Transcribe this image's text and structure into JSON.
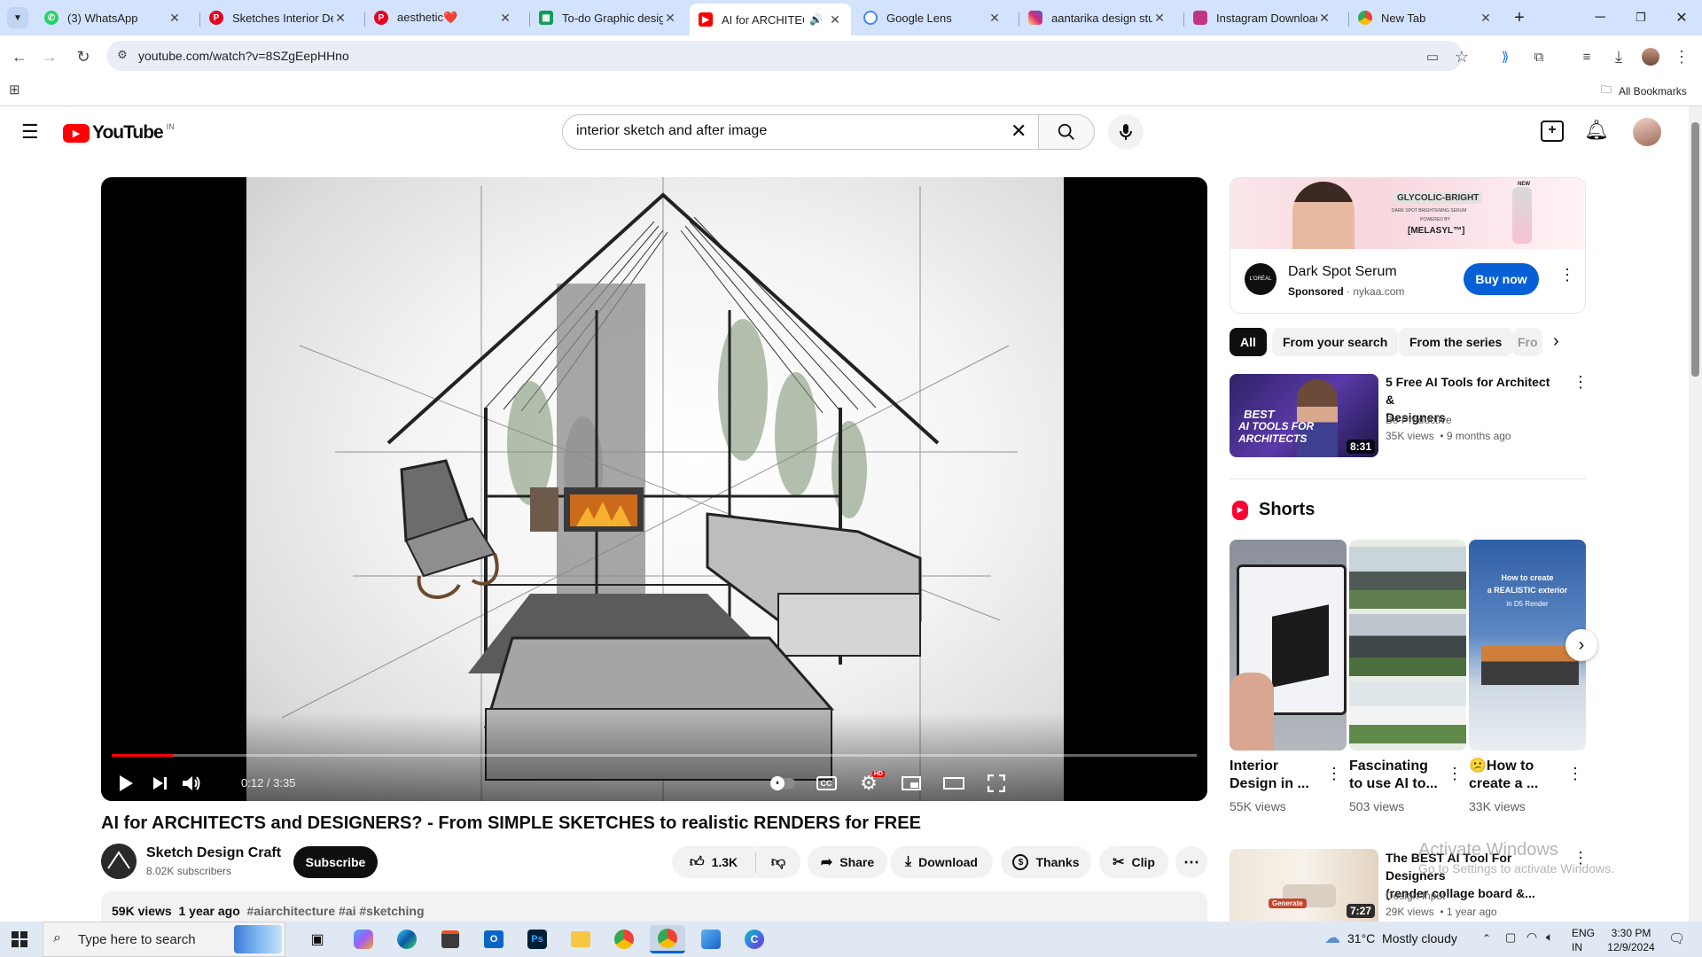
{
  "browser": {
    "tabs": [
      {
        "title": "(3) WhatsApp",
        "favicon": "whatsapp-icon",
        "color": "#25d366"
      },
      {
        "title": "Sketches Interior Des",
        "favicon": "pinterest-icon",
        "color": "#e60023"
      },
      {
        "title": "aesthetic❤️",
        "favicon": "pinterest-icon",
        "color": "#e60023"
      },
      {
        "title": "To-do Graphic design",
        "favicon": "sheets-icon",
        "color": "#0f9d58"
      },
      {
        "title": "AI for ARCHITECT",
        "favicon": "youtube-icon",
        "color": "#ff0000"
      },
      {
        "title": "Google Lens",
        "favicon": "google-lens-icon",
        "color": "#4285f4"
      },
      {
        "title": "aantarika design stud",
        "favicon": "instagram-icon",
        "color": "#d62976"
      },
      {
        "title": "Instagram Download",
        "favicon": "instagram-download-icon",
        "color": "#c13584"
      },
      {
        "title": "New Tab",
        "favicon": "chrome-icon",
        "color": "#5f6368"
      }
    ],
    "active_tab": 4,
    "url": "youtube.com/watch?v=8SZgEepHHno",
    "bookmarks_label": "All Bookmarks"
  },
  "youtube": {
    "logo_text": "YouTube",
    "region": "IN",
    "search_value": "interior sketch and after image"
  },
  "player": {
    "time_current": "0:12",
    "time_sep": " / ",
    "time_total": "3:35",
    "progress": 0.056
  },
  "video": {
    "title": "AI for ARCHITECTS and DESIGNERS? - From SIMPLE SKETCHES to realistic RENDERS for FREE",
    "channel": "Sketch Design Craft",
    "subscribers": "8.02K subscribers",
    "subscribe_label": "Subscribe",
    "likes": "1.3K",
    "share_label": "Share",
    "download_label": "Download",
    "thanks_label": "Thanks",
    "clip_label": "Clip",
    "views": "59K views",
    "age": "1 year ago",
    "hashtags": "#aiarchitecture #ai #sketching"
  },
  "ad": {
    "banner_brand": "GLYCOLIC-BRIGHT",
    "banner_line": "DARK SPOT BRIGHTENING SERUM",
    "banner_powered": "POWERED BY",
    "banner_ingredient": "[MELASYL™]",
    "banner_new": "NEW",
    "logo": "L'ORÉAL",
    "title": "Dark Spot Serum",
    "sponsored": "Sponsored",
    "domain": "nykaa.com",
    "cta": "Buy now"
  },
  "chips": [
    "All",
    "From your search",
    "From the series",
    "Fro"
  ],
  "recommendations": [
    {
      "title_line1": "5 Free AI Tools for Architect &",
      "title_line2": "Designers",
      "channel": "Be Productive",
      "meta": "35K views  • 9 months ago",
      "duration": "8:31",
      "thumb_line1": "BEST",
      "thumb_line2": "AI TOOLS FOR",
      "thumb_line3": "ARCHITECTS"
    },
    {
      "title_line1": "The BEST AI Tool For Designers",
      "title_line2": "(render collage board &...",
      "channel": "Design Input",
      "meta": "29K views  • 1 year ago",
      "duration": "7:27",
      "thumb_label": "Generate"
    }
  ],
  "shorts": {
    "heading": "Shorts",
    "items": [
      {
        "title_line1": "Interior",
        "title_line2": "Design in ...",
        "views": "55K views"
      },
      {
        "title_line1": "Fascinating",
        "title_line2": "to use AI to...",
        "views": "503 views"
      },
      {
        "title_line1": "😕How to",
        "title_line2": "create a ...",
        "views": "33K views",
        "thumb_line1": "How to create",
        "thumb_line2": "a REALISTIC exterior",
        "thumb_line3": "in D5 Render"
      }
    ]
  },
  "watermark": {
    "line1": "Activate Windows",
    "line2": "Go to Settings to activate Windows."
  },
  "taskbar": {
    "search_placeholder": "Type here to search",
    "weather": "31°C  Mostly cloudy",
    "lang_line1": "ENG",
    "lang_line2": "IN",
    "time": "3:30 PM",
    "date": "12/9/2024"
  }
}
